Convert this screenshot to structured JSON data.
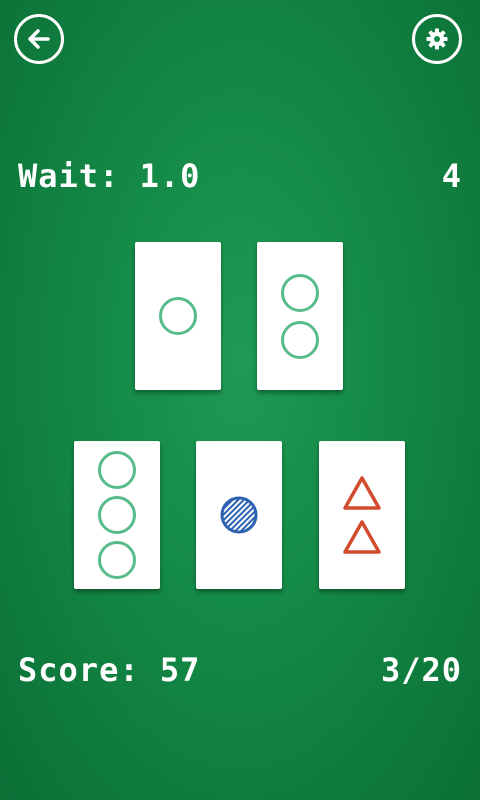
{
  "header": {
    "back_icon": "arrow-left-icon",
    "settings_icon": "gear-icon"
  },
  "hud": {
    "wait_label": "Wait: 1.0",
    "sets_remaining": "4",
    "score_label": "Score: 57",
    "progress": "3/20"
  },
  "colors": {
    "green_shape": "#58bb8a",
    "blue_shape": "#2d62b3",
    "red_shape": "#d24b2c",
    "felt": "#138845"
  },
  "cards": [
    {
      "count": 1,
      "shape": "circle",
      "fill": "outline",
      "color": "green"
    },
    {
      "count": 2,
      "shape": "circle",
      "fill": "outline",
      "color": "green"
    },
    {
      "count": 3,
      "shape": "circle",
      "fill": "outline",
      "color": "green"
    },
    {
      "count": 1,
      "shape": "circle",
      "fill": "striped",
      "color": "blue"
    },
    {
      "count": 2,
      "shape": "triangle",
      "fill": "outline",
      "color": "red"
    }
  ]
}
